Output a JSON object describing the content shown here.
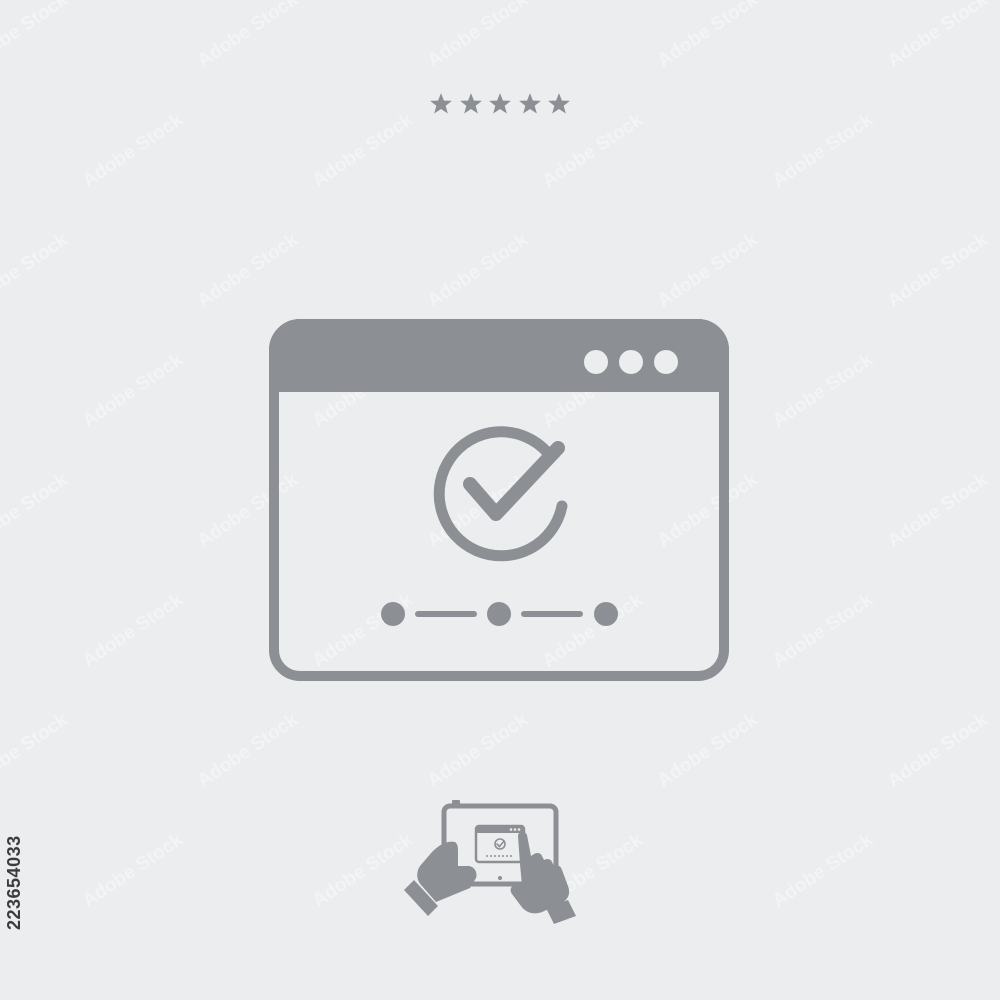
{
  "rating": {
    "stars": 5,
    "filled": 5,
    "color": "#8c8f93"
  },
  "colors": {
    "background": "#ecedef",
    "icon": "#8c8f93",
    "icon_light": "#ecedef"
  },
  "main_icon": {
    "name": "browser-window-checkmark-icon",
    "window_dots": 3,
    "progress_steps": 3
  },
  "preview_icon": {
    "name": "tablet-touch-hands-icon"
  },
  "stock_id": "223654033",
  "watermark_text": "Adobe Stock"
}
